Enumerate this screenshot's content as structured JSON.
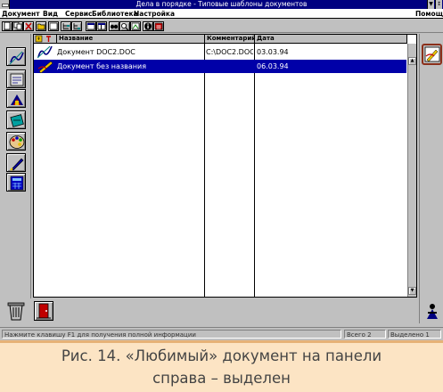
{
  "window": {
    "title": "Дела в порядке - Типовые шаблоны документов",
    "min_glyph": "▼",
    "restore_glyph": "↕"
  },
  "menu": {
    "items": [
      "Документ",
      "Вид",
      "Сервис",
      "Библиотека",
      "Настройка"
    ],
    "help": "Помощь"
  },
  "toolbar": {
    "icons": [
      "new-doc-icon",
      "copy-doc-icon",
      "delete-icon",
      "open-folder-icon",
      "list-view-icon",
      "tree-view-icon",
      "tree-view-2-icon",
      "window-icon",
      "window-2-icon",
      "binoculars-icon",
      "magnifier-icon",
      "image-edit-icon",
      "info-icon",
      "calendar-icon"
    ]
  },
  "columns": [
    "Название",
    "Комментарий",
    "Дата"
  ],
  "documents": [
    {
      "name": "Документ DOC2.DOC",
      "comment": "C:\\DOC2.DOC",
      "date": "03.03.94",
      "selected": false
    },
    {
      "name": "Документ без названия",
      "comment": "",
      "date": "06.03.94",
      "selected": true
    }
  ],
  "left_panel": {
    "icons": [
      "writing-doc-icon",
      "archive-doc-icon",
      "library-icon",
      "stamp-icon",
      "palette-icon",
      "pen-icon",
      "calculator-icon"
    ]
  },
  "right_panel": {
    "icons": [
      "favorite-document-icon",
      "exit-person-icon"
    ]
  },
  "bottom": {
    "icons": [
      "trash-icon",
      "exit-door-icon"
    ]
  },
  "status": {
    "hint": "Нажмите клавишу F1 для получения полной информации",
    "total": "Всего 2",
    "selected": "Выделено 1"
  },
  "caption": {
    "line1": "Рис. 14. «Любимый» документ на панели",
    "line2": "справа – выделен"
  },
  "colors": {
    "titlebar": "#000080",
    "selection": "#0000a8",
    "face": "#c0c0c0",
    "caption_bg": "#fce4c4",
    "caption_border": "#e6b277",
    "highlight_border": "#8b2f1a"
  }
}
